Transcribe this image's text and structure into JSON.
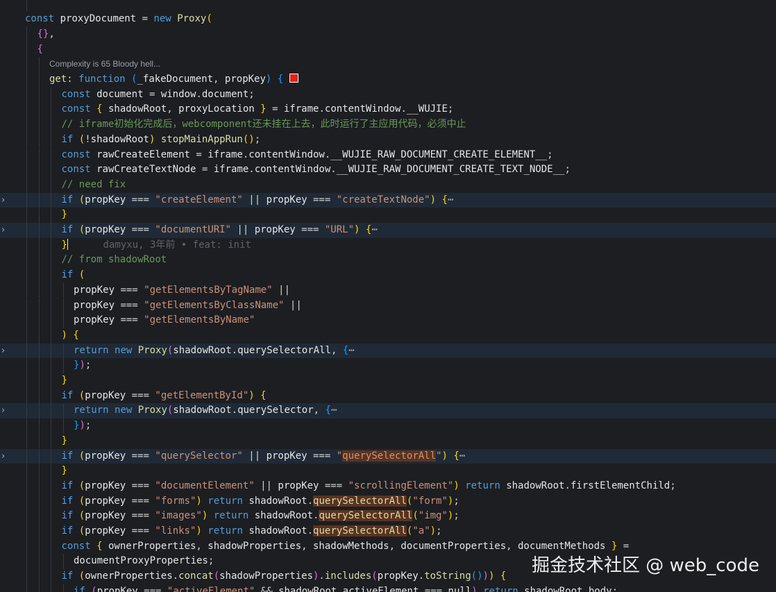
{
  "editor": {
    "codelens": "Complexity is 65 Bloody hell...",
    "blame": "damyxu, 3年前 • feat: init",
    "ellipsis": "⋯",
    "fold_icon": "chevron-right-icon"
  },
  "watermark": "掘金技术社区 @ web_code",
  "lines": [
    "",
    "const proxyDocument = new Proxy(",
    "{},",
    "{",
    "",
    "get: function (_fakeDocument, propKey) {",
    "const document = window.document;",
    "const { shadowRoot, proxyLocation } = iframe.contentWindow.__WUJIE;",
    "// iframe初始化完成后，webcomponent还未挂在上去，此时运行了主应用代码，必须中止",
    "if (!shadowRoot) stopMainAppRun();",
    "const rawCreateElement = iframe.contentWindow.__WUJIE_RAW_DOCUMENT_CREATE_ELEMENT__;",
    "const rawCreateTextNode = iframe.contentWindow.__WUJIE_RAW_DOCUMENT_CREATE_TEXT_NODE__;",
    "// need fix",
    "if (propKey === \"createElement\" || propKey === \"createTextNode\") {",
    "}",
    "if (propKey === \"documentURI\" || propKey === \"URL\") {",
    "}",
    "// from shadowRoot",
    "if (",
    "propKey === \"getElementsByTagName\" ||",
    "propKey === \"getElementsByClassName\" ||",
    "propKey === \"getElementsByName\"",
    ") {",
    "return new Proxy(shadowRoot.querySelectorAll, {",
    "});",
    "}",
    "if (propKey === \"getElementById\") {",
    "return new Proxy(shadowRoot.querySelector, {",
    "});",
    "}",
    "if (propKey === \"querySelector\" || propKey === \"querySelectorAll\") {",
    "}",
    "if (propKey === \"documentElement\" || propKey === \"scrollingElement\") return shadowRoot.firstElementChild;",
    "if (propKey === \"forms\") return shadowRoot.querySelectorAll(\"form\");",
    "if (propKey === \"images\") return shadowRoot.querySelectorAll(\"img\");",
    "if (propKey === \"links\") return shadowRoot.querySelectorAll(\"a\");",
    "const { ownerProperties, shadowProperties, shadowMethods, documentProperties, documentMethods } =",
    "documentProxyProperties;",
    "if (ownerProperties.concat(shadowProperties).includes(propKey.toString())) {",
    "if (propKey === \"activeElement\" && shadowRoot.activeElement === null) return shadowRoot.body;"
  ]
}
